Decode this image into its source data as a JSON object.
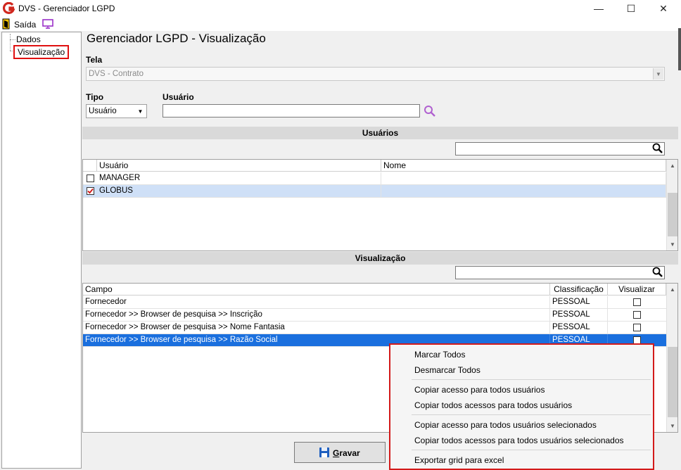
{
  "window": {
    "title": "DVS - Gerenciador LGPD",
    "minimize": "—",
    "maximize": "☐",
    "close": "✕"
  },
  "menu": {
    "exit_label": "Saída"
  },
  "tree": {
    "items": [
      "Dados",
      "Visualização"
    ]
  },
  "page_title": "Gerenciador LGPD - Visualização",
  "tela": {
    "label": "Tela",
    "value": "DVS - Contrato"
  },
  "tipo": {
    "label": "Tipo",
    "value": "Usuário"
  },
  "usuario": {
    "label": "Usuário",
    "value": ""
  },
  "users_section": {
    "title": "Usuários",
    "search_value": "",
    "columns": [
      "Usuário",
      "Nome"
    ],
    "rows": [
      {
        "usuario": "MANAGER",
        "nome": "",
        "checked": false
      },
      {
        "usuario": "GLOBUS",
        "nome": "",
        "checked": true
      }
    ]
  },
  "visual_section": {
    "title": "Visualização",
    "search_value": "",
    "columns": [
      "Campo",
      "Classificação",
      "Visualizar"
    ],
    "rows": [
      {
        "campo": "Fornecedor",
        "classificacao": "PESSOAL"
      },
      {
        "campo": "Fornecedor >> Browser de pesquisa >> Inscrição",
        "classificacao": "PESSOAL"
      },
      {
        "campo": "Fornecedor >> Browser de pesquisa >> Nome Fantasia",
        "classificacao": "PESSOAL"
      },
      {
        "campo": "Fornecedor >> Browser de pesquisa >> Razão Social",
        "classificacao": "PESSOAL"
      }
    ]
  },
  "context_menu": {
    "items": [
      "Marcar Todos",
      "Desmarcar Todos",
      "Copiar acesso para todos usuários",
      "Copiar todos acessos para todos usuários",
      "Copiar acesso para todos usuários selecionados",
      "Copiar todos acessos para todos usuários selecionados",
      "Exportar grid para excel"
    ]
  },
  "save_button": {
    "label_first": "G",
    "label_rest": "ravar"
  },
  "colors": {
    "selection": "#1a6fde",
    "selected_row_light": "#cfe0f7",
    "highlight_border": "#e01010",
    "logo": "#d0271e"
  }
}
